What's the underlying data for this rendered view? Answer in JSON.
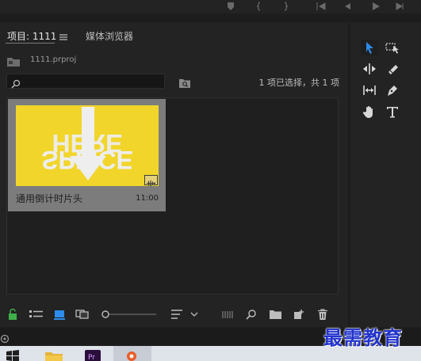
{
  "project_panel": {
    "tab_title": "项目: 1111",
    "tab_media_browser": "媒体浏览器",
    "project_file": "1111.prproj",
    "search": {
      "value": "",
      "placeholder": ""
    },
    "selection_status": "1 项已选择，共 1 项"
  },
  "clip": {
    "name": "通用倒计时片头",
    "duration": "11:00",
    "thumbnail_text_top": "HERE",
    "thumbnail_text_bottom": "SPLICE",
    "thumbnail_color": "#f1d52a"
  },
  "tools": {
    "items": [
      "selection-tool",
      "track-select-tool",
      "ripple-edit-tool",
      "razor-tool",
      "slip-tool",
      "pen-tool",
      "hand-tool",
      "type-tool"
    ],
    "active": "selection-tool",
    "accent": "#2d8ceb"
  },
  "bottom_toolbar": {
    "zoom": 0.0
  },
  "watermark": "最需教育"
}
